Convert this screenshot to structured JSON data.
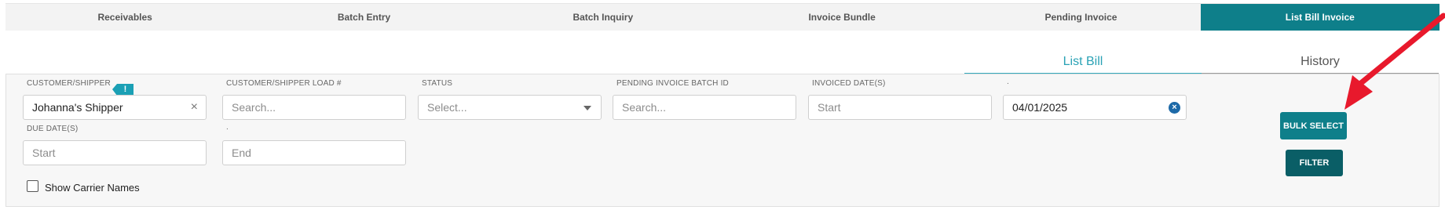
{
  "tabs": [
    "Receivables",
    "Batch Entry",
    "Batch Inquiry",
    "Invoice Bundle",
    "Pending Invoice",
    "List Bill Invoice"
  ],
  "active_tab": "List Bill Invoice",
  "subtabs": {
    "list_bill": "List Bill",
    "history": "History"
  },
  "filters": {
    "customer_label": "CUSTOMER/SHIPPER",
    "customer_value": "Johanna's Shipper",
    "customer_load_label": "CUSTOMER/SHIPPER LOAD #",
    "customer_load_placeholder": "Search...",
    "status_label": "STATUS",
    "status_placeholder": "Select...",
    "batch_id_label": "PENDING INVOICE BATCH ID",
    "batch_id_placeholder": "Search...",
    "invoiced_label": "INVOICED DATE(S)",
    "invoiced_start_placeholder": "Start",
    "invoiced_end_label": ".",
    "invoiced_end_value": "04/01/2025",
    "due_label": "DUE DATE(S)",
    "due_start_placeholder": "Start",
    "due_end_label": ".",
    "due_end_placeholder": "End",
    "show_carrier_label": "Show Carrier Names",
    "show_carrier_checked": false
  },
  "buttons": {
    "bulk_select": "BULK SELECT",
    "filter": "FILTER"
  },
  "icons": {
    "clear": "×",
    "clear_circle": "×",
    "info_badge": "!"
  },
  "colors": {
    "accent": "#0e7f8a",
    "link": "#2aa2b5",
    "annotation_arrow": "#e8192c"
  }
}
